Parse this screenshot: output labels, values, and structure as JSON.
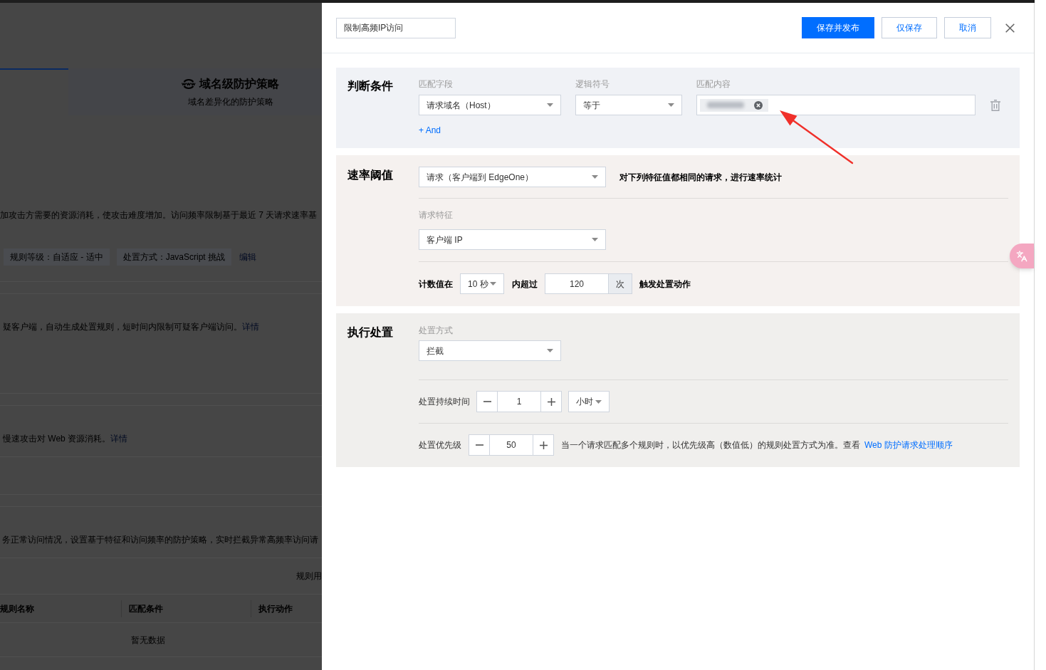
{
  "background_page": {
    "tabs": [
      {
        "selected": true
      },
      {
        "title": "域名级防护策略",
        "subtitle": "域名差异化的防护策略",
        "selected": false
      }
    ],
    "overview": {
      "description": "加攻击方需要的资源消耗，使攻击难度增加。访问频率限制基于最近 7 天请求速率基",
      "tags": [
        "规则等级：自适应 - 适中",
        "处置方式：JavaScript 挑战"
      ],
      "edit_link": "编辑"
    },
    "features": [
      {
        "description": "疑客户端，自动生成处置规则，短时间内限制可疑客户端访问。",
        "link": "详情"
      },
      {
        "description": "慢速攻击对 Web 资源消耗。",
        "link": "详情"
      }
    ],
    "rate_limit": {
      "description": "务正常访问情况，设置基于特征和访问频率的防护策略，实时拦截异常高频率访问请",
      "toolbar_text": "规则用",
      "columns": [
        "规则名称",
        "匹配条件",
        "执行动作"
      ],
      "empty_text": "暂无数据"
    }
  },
  "drawer": {
    "rule_name": "限制高频IP访问",
    "buttons": [
      {
        "label": "保存并发布",
        "kind": "primary"
      },
      {
        "label": "仅保存",
        "kind": "default"
      },
      {
        "label": "取消",
        "kind": "default"
      }
    ],
    "condition": {
      "title": "判断条件",
      "fields": [
        {
          "label": "匹配字段",
          "kind": "select",
          "value": "请求域名（Host）"
        },
        {
          "label": "逻辑符号",
          "kind": "select",
          "value": "等于"
        },
        {
          "label": "匹配内容",
          "kind": "tag_input"
        }
      ],
      "add_link": "+ And"
    },
    "rate": {
      "title": "速率阈值",
      "scope": "请求（客户端到 EdgeOne）",
      "scope_note": "对下列特征值都相同的请求，进行速率统计",
      "feature_label": "请求特征",
      "feature": "客户端 IP",
      "count_prefix": "计数值在",
      "period": "10 秒",
      "count_middle": "内超过",
      "threshold": "120",
      "threshold_unit": "次",
      "count_suffix": "触发处置动作"
    },
    "action": {
      "title": "执行处置",
      "method_label": "处置方式",
      "method": "拦截",
      "duration_label": "处置持续时间",
      "duration": "1",
      "duration_unit": "小时",
      "priority_label": "处置优先级",
      "priority": "50",
      "priority_note": "当一个请求匹配多个规则时，以优先级高（数值低）的规则处置方式为准。查看",
      "priority_link": "Web 防护请求处理顺序"
    }
  }
}
